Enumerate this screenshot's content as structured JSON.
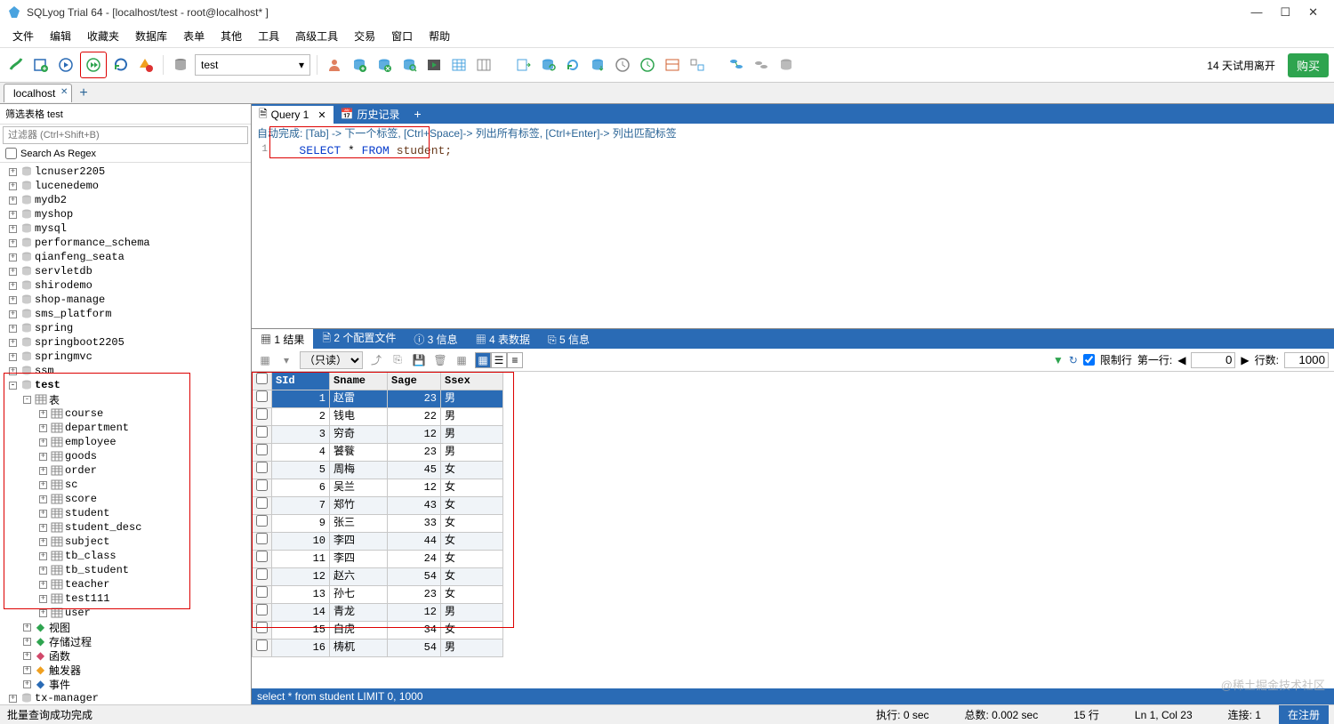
{
  "window": {
    "title": "SQLyog Trial 64 - [localhost/test - root@localhost* ]"
  },
  "menu": [
    "文件",
    "编辑",
    "收藏夹",
    "数据库",
    "表单",
    "其他",
    "工具",
    "高级工具",
    "交易",
    "窗口",
    "帮助"
  ],
  "toolbar": {
    "db_selected": "test",
    "trial_text": "14 天试用离开",
    "buy_label": "购买"
  },
  "conn_tab": {
    "label": "localhost"
  },
  "left": {
    "filter_header": "筛选表格 test",
    "filter_placeholder": "过滤器 (Ctrl+Shift+B)",
    "regex_label": "Search As Regex",
    "databases": [
      "lcnuser2205",
      "lucenedemo",
      "mydb2",
      "myshop",
      "mysql",
      "performance_schema",
      "qianfeng_seata",
      "servletdb",
      "shirodemo",
      "shop-manage",
      "sms_platform",
      "spring",
      "springboot2205",
      "springmvc",
      "ssm"
    ],
    "test_db": "test",
    "tables_label": "表",
    "tables": [
      "course",
      "department",
      "employee",
      "goods",
      "order",
      "sc",
      "score",
      "student",
      "student_desc",
      "subject",
      "tb_class",
      "tb_student",
      "teacher",
      "test111",
      "user"
    ],
    "folders": [
      {
        "label": "视图",
        "color": "#2ea44f"
      },
      {
        "label": "存储过程",
        "color": "#2ea44f"
      },
      {
        "label": "函数",
        "color": "#d1486a"
      },
      {
        "label": "触发器",
        "color": "#f0a020"
      },
      {
        "label": "事件",
        "color": "#2a6bb5"
      }
    ],
    "after_db": "tx-manager"
  },
  "query_tabs": {
    "active": "Query 1",
    "history": "历史记录"
  },
  "hint": "自动完成:  [Tab] -> 下一个标签,  [Ctrl+Space]-> 列出所有标签,  [Ctrl+Enter]-> 列出匹配标签",
  "code": {
    "line_no": "1",
    "kw1": "SELECT",
    "star": "*",
    "kw2": "FROM",
    "tbl": "student;"
  },
  "result_tabs": [
    "▦ 1 结果",
    "🗎 2 个配置文件",
    "ⓘ 3 信息",
    "▦ 4 表数据",
    "⎘ 5 信息"
  ],
  "result_tbar": {
    "mode_label": "（只读）",
    "limit_label": "限制行",
    "first_row_label": "第一行:",
    "first_row_val": "0",
    "rows_label": "行数:",
    "rows_val": "1000"
  },
  "grid": {
    "cols": [
      "SId",
      "Sname",
      "Sage",
      "Ssex"
    ],
    "rows": [
      {
        "SId": "1",
        "Sname": "赵雷",
        "Sage": "23",
        "Ssex": "男"
      },
      {
        "SId": "2",
        "Sname": "钱电",
        "Sage": "22",
        "Ssex": "男"
      },
      {
        "SId": "3",
        "Sname": "穷奇",
        "Sage": "12",
        "Ssex": "男"
      },
      {
        "SId": "4",
        "Sname": "饕餮",
        "Sage": "23",
        "Ssex": "男"
      },
      {
        "SId": "5",
        "Sname": "周梅",
        "Sage": "45",
        "Ssex": "女"
      },
      {
        "SId": "6",
        "Sname": "吴兰",
        "Sage": "12",
        "Ssex": "女"
      },
      {
        "SId": "7",
        "Sname": "郑竹",
        "Sage": "43",
        "Ssex": "女"
      },
      {
        "SId": "9",
        "Sname": "张三",
        "Sage": "33",
        "Ssex": "女"
      },
      {
        "SId": "10",
        "Sname": "李四",
        "Sage": "44",
        "Ssex": "女"
      },
      {
        "SId": "11",
        "Sname": "李四",
        "Sage": "24",
        "Ssex": "女"
      },
      {
        "SId": "12",
        "Sname": "赵六",
        "Sage": "54",
        "Ssex": "女"
      },
      {
        "SId": "13",
        "Sname": "孙七",
        "Sage": "23",
        "Ssex": "女"
      },
      {
        "SId": "14",
        "Sname": "青龙",
        "Sage": "12",
        "Ssex": "男"
      },
      {
        "SId": "15",
        "Sname": "白虎",
        "Sage": "34",
        "Ssex": "女"
      },
      {
        "SId": "16",
        "Sname": "梼杌",
        "Sage": "54",
        "Ssex": "男"
      }
    ]
  },
  "query_status": "select * from student LIMIT 0, 1000",
  "status": {
    "left": "批量查询成功完成",
    "exec": "执行: 0 sec",
    "total": "总数: 0.002 sec",
    "rows": "15 行",
    "pos": "Ln 1, Col 23",
    "conn": "连接: 1",
    "reg": "在注册"
  },
  "watermark": "@稀土掘金技术社区"
}
